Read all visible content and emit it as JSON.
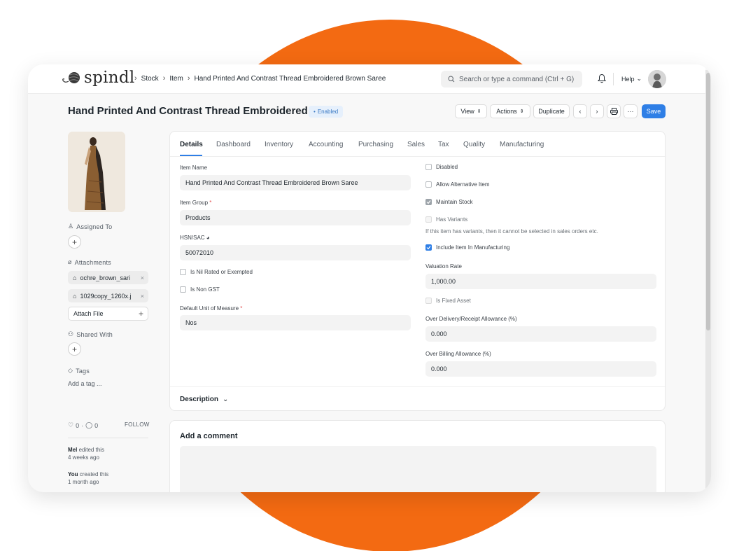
{
  "app": {
    "brand": "spindl",
    "colors": {
      "accent": "#2f7fe6",
      "background_circle": "#f36a12",
      "enabled_badge": "#3a79c4"
    }
  },
  "navbar": {
    "breadcrumbs": [
      "Stock",
      "Item",
      "Hand Printed And Contrast Thread Embroidered Brown Saree"
    ],
    "search_placeholder": "Search or type a command (Ctrl + G)",
    "help_label": "Help"
  },
  "header": {
    "title": "Hand Printed And Contrast Thread Embroidered ...",
    "status": "Enabled",
    "view_label": "View",
    "actions_label": "Actions",
    "duplicate_label": "Duplicate",
    "more_label": "···",
    "save_label": "Save"
  },
  "sidebar": {
    "assigned_to": "Assigned To",
    "attachments_label": "Attachments",
    "attachments": [
      "ochre_brown_sari",
      "1029copy_1260x.j"
    ],
    "attach_file": "Attach File",
    "shared_with": "Shared With",
    "tags_label": "Tags",
    "add_tag": "Add a tag ...",
    "likes": "0",
    "comments": "0",
    "follow": "FOLLOW",
    "activity": [
      {
        "who": "Mel",
        "what": "edited this",
        "when": "4 weeks ago"
      },
      {
        "who": "You",
        "what": "created this",
        "when": "1 month ago"
      }
    ]
  },
  "tabs": [
    "Details",
    "Dashboard",
    "Inventory",
    "Accounting",
    "Purchasing",
    "Sales",
    "Tax",
    "Quality",
    "Manufacturing"
  ],
  "form": {
    "item_name_label": "Item Name",
    "item_name": "Hand Printed And Contrast Thread Embroidered Brown Saree",
    "item_group_label": "Item Group",
    "item_group": "Products",
    "hsn_label": "HSN/SAC",
    "hsn": "50072010",
    "nil_rated": "Is Nil Rated or Exempted",
    "non_gst": "Is Non GST",
    "uom_label": "Default Unit of Measure",
    "uom": "Nos",
    "disabled": "Disabled",
    "allow_alt": "Allow Alternative Item",
    "maintain_stock": "Maintain Stock",
    "has_variants": "Has Variants",
    "variants_help": "If this item has variants, then it cannot be selected in sales orders etc.",
    "include_mfg": "Include Item In Manufacturing",
    "valuation_label": "Valuation Rate",
    "valuation": "1,000.00",
    "fixed_asset": "Is Fixed Asset",
    "over_delivery_label": "Over Delivery/Receipt Allowance (%)",
    "over_delivery": "0.000",
    "over_billing_label": "Over Billing Allowance (%)",
    "over_billing": "0.000"
  },
  "description_label": "Description",
  "comment": {
    "title": "Add a comment"
  }
}
